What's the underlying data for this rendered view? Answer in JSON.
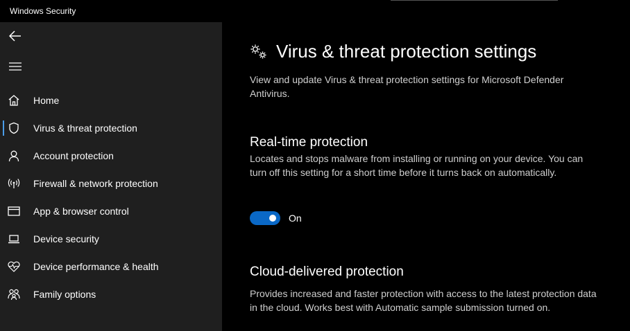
{
  "window": {
    "title": "Windows Security"
  },
  "sidebar": {
    "back_icon": "back-arrow-icon",
    "menu_icon": "hamburger-menu-icon",
    "items": [
      {
        "label": "Home",
        "icon": "home-icon"
      },
      {
        "label": "Virus & threat protection",
        "icon": "shield-icon",
        "active": true
      },
      {
        "label": "Account protection",
        "icon": "person-icon"
      },
      {
        "label": "Firewall & network protection",
        "icon": "antenna-icon"
      },
      {
        "label": "App & browser control",
        "icon": "browser-window-icon"
      },
      {
        "label": "Device security",
        "icon": "laptop-icon"
      },
      {
        "label": "Device performance & health",
        "icon": "heart-pulse-icon"
      },
      {
        "label": "Family options",
        "icon": "family-icon"
      }
    ]
  },
  "main": {
    "title": "Virus & threat protection settings",
    "title_icon": "gears-icon",
    "description": "View and update Virus & threat protection settings for Microsoft Defender Antivirus.",
    "sections": [
      {
        "title": "Real-time protection",
        "description": "Locates and stops malware from installing or running on your device. You can turn off this setting for a short time before it turns back on automatically.",
        "toggle": {
          "state": "On"
        }
      },
      {
        "title": "Cloud-delivered protection",
        "description": "Provides increased and faster protection with access to the latest protection data in the cloud. Works best with Automatic sample submission turned on."
      }
    ]
  },
  "colors": {
    "sidebar_bg": "#1f1f1f",
    "main_bg": "#000000",
    "accent": "#0a68c6",
    "active_marker": "#4a9ce8"
  }
}
